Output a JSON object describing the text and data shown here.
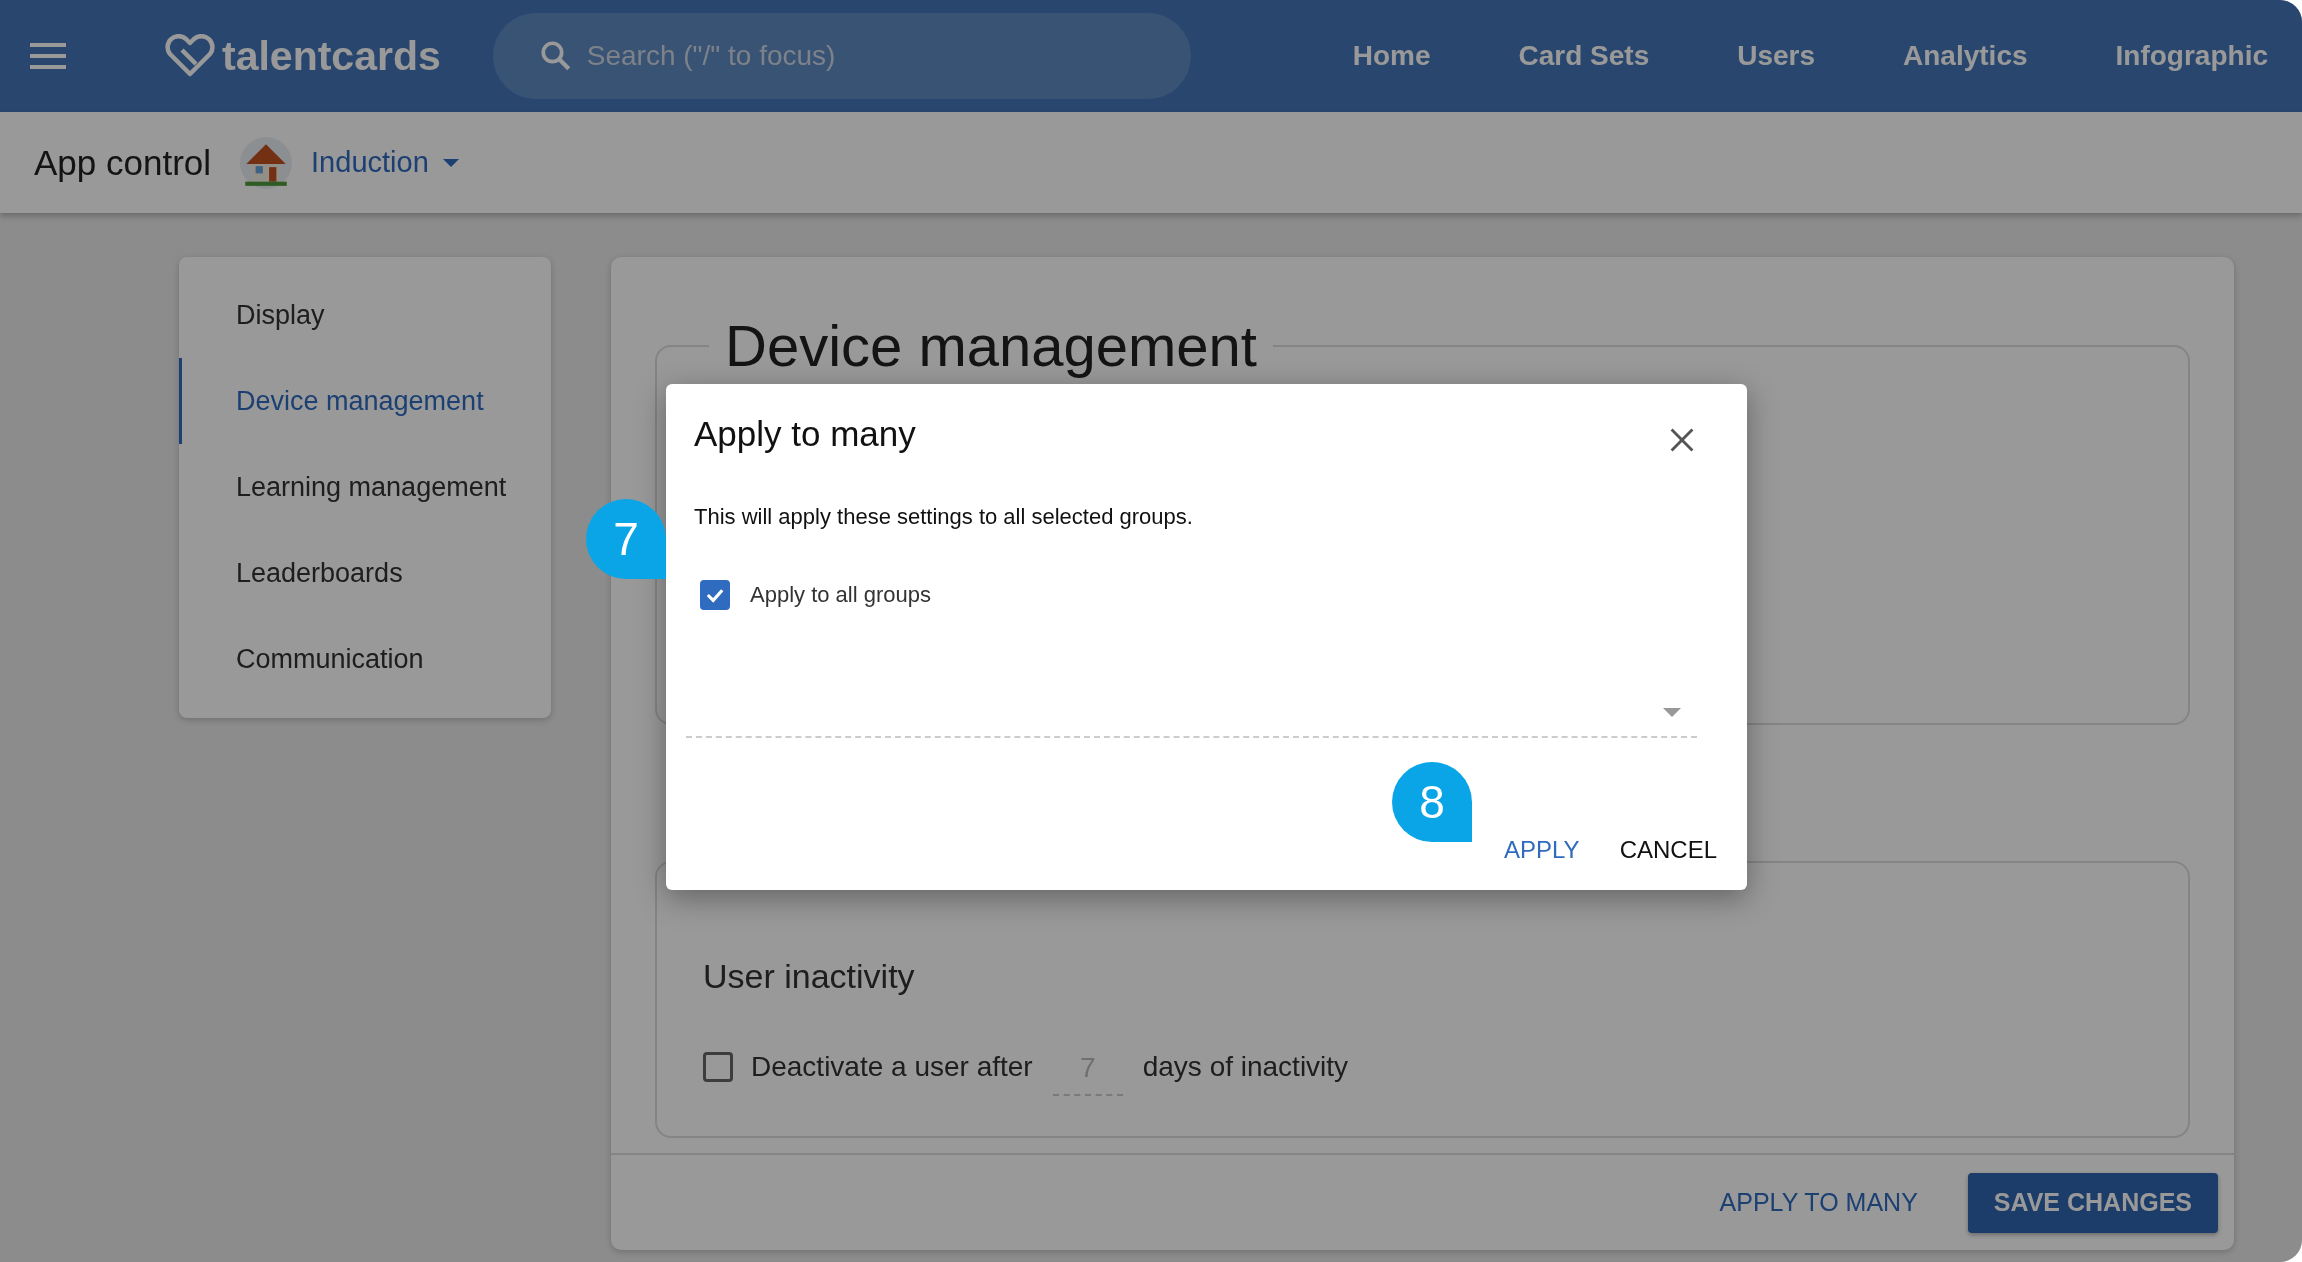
{
  "header": {
    "logo": "talentcards",
    "search": {
      "placeholder": "Search (\"/\" to focus)"
    },
    "nav": [
      {
        "label": "Home"
      },
      {
        "label": "Card Sets"
      },
      {
        "label": "Users"
      },
      {
        "label": "Analytics"
      },
      {
        "label": "Infographic"
      }
    ]
  },
  "subheader": {
    "title": "App control",
    "group": "Induction"
  },
  "sidebar": {
    "items": [
      {
        "label": "Display",
        "selected": false
      },
      {
        "label": "Device management",
        "selected": true
      },
      {
        "label": "Learning management",
        "selected": false
      },
      {
        "label": "Leaderboards",
        "selected": false
      },
      {
        "label": "Communication",
        "selected": false
      }
    ]
  },
  "sections": [
    {
      "title": "Device management"
    },
    {
      "subtitle": "User inactivity",
      "option": {
        "checked": false,
        "before": "Deactivate a user after",
        "placeholder": "7",
        "after": "days of inactivity"
      }
    }
  ],
  "footer": {
    "buttons": [
      {
        "label": "APPLY TO MANY",
        "kind": "text"
      },
      {
        "label": "SAVE CHANGES",
        "kind": "filled"
      }
    ]
  },
  "dialog": {
    "title": "Apply to many",
    "message": "This will apply these settings to all selected groups.",
    "checkbox": {
      "label": "Apply to all groups",
      "checked": true
    },
    "buttons": [
      {
        "label": "APPLY",
        "kind": "primary"
      },
      {
        "label": "CANCEL",
        "kind": "plain"
      }
    ]
  },
  "callouts": [
    {
      "label": "7"
    },
    {
      "label": "8"
    }
  ]
}
